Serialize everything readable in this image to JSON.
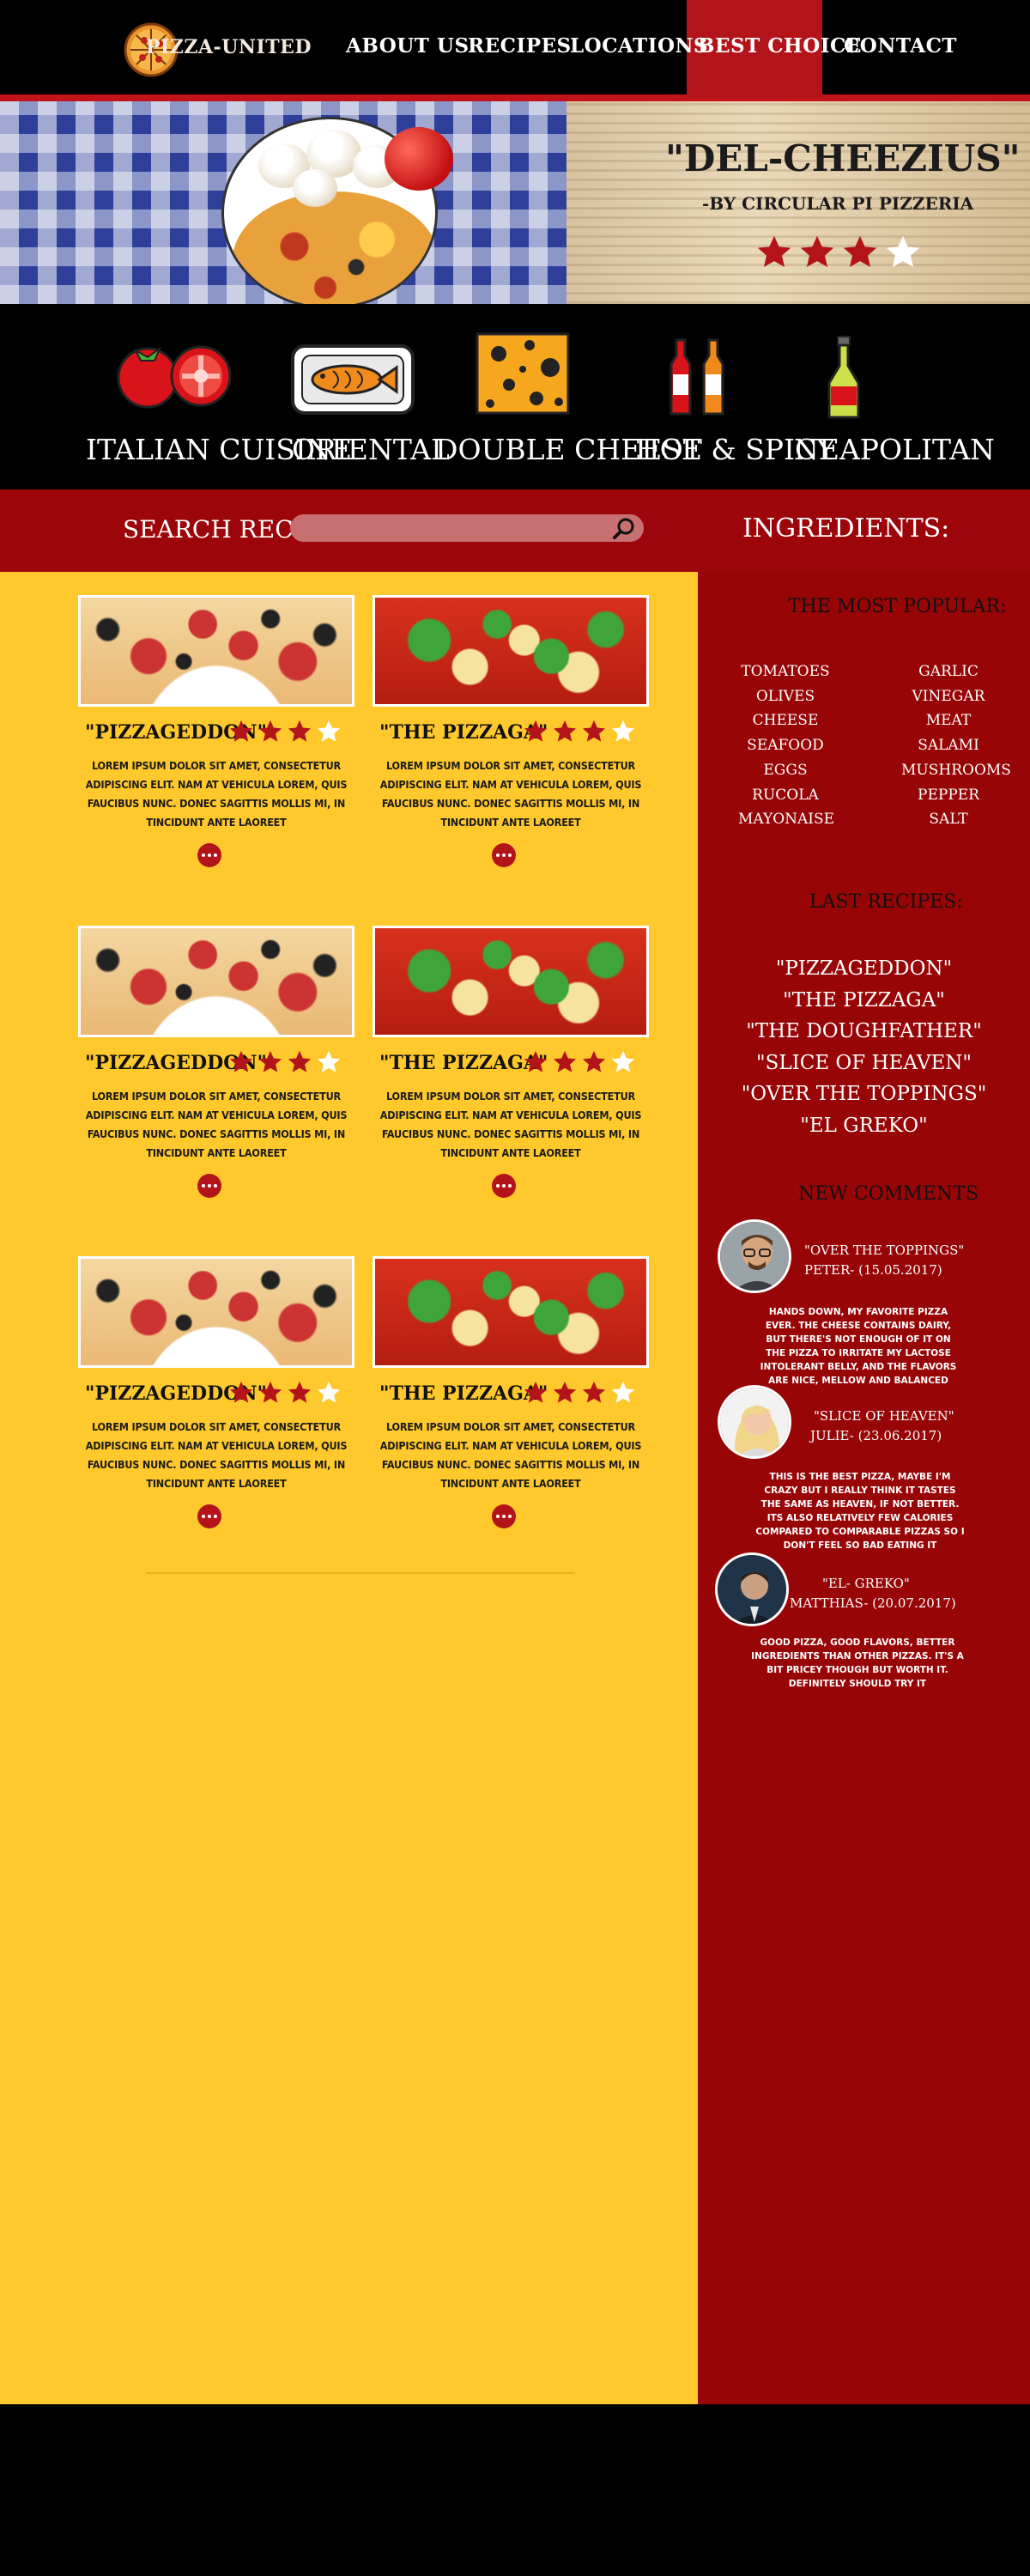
{
  "brand": {
    "name": "PIZZA-UNITED"
  },
  "nav": {
    "items": [
      {
        "label": "ABOUT US"
      },
      {
        "label": "RECIPES"
      },
      {
        "label": "LOCATIONS"
      },
      {
        "label": "BEST CHOICE",
        "active": true
      },
      {
        "label": "CONTACT"
      }
    ]
  },
  "hero": {
    "title": "\"DEL-CHEEZIUS\"",
    "subtitle": "-BY CIRCULAR PI PIZZERIA",
    "rating": 3,
    "rating_max": 4
  },
  "categories": [
    {
      "label": "ITALIAN CUISINE",
      "icon": "tomato-icon"
    },
    {
      "label": "ORIENTAL",
      "icon": "fish-icon"
    },
    {
      "label": "DOUBLE CHEESE",
      "icon": "cheese-icon"
    },
    {
      "label": "HOT & SPICY",
      "icon": "sauce-bottles-icon"
    },
    {
      "label": "NEAPOLITAN",
      "icon": "oil-bottle-icon"
    }
  ],
  "search": {
    "label": "SEARCH RECIPES:",
    "placeholder": "",
    "value": ""
  },
  "ingredients": {
    "title": "INGREDIENTS:",
    "popular_title": "THE MOST POPULAR:",
    "left": [
      "TOMATOES",
      "OLIVES",
      "CHEESE",
      "SEAFOOD",
      "EGGS",
      "RUCOLA",
      "MAYONAISE"
    ],
    "right": [
      "GARLIC",
      "VINEGAR",
      "MEAT",
      "SALAMI",
      "MUSHROOMS",
      "PEPPER",
      "SALT"
    ]
  },
  "last_recipes": {
    "title": "LAST RECIPES:",
    "items": [
      "\"PIZZAGEDDON\"",
      "\"THE PIZZAGA\"",
      "\"THE DOUGHFATHER\"",
      "\"SLICE OF HEAVEN\"",
      "\"OVER THE TOPPINGS\"",
      "\"EL GREKO\""
    ]
  },
  "comments": {
    "title": "NEW COMMENTS",
    "items": [
      {
        "recipe": "\"OVER THE TOPPINGS\"",
        "author": "PETER- (15.05.2017)",
        "body": "HANDS DOWN, MY FAVORITE PIZZA EVER. THE CHEESE CONTAINS DAIRY, BUT THERE'S NOT ENOUGH OF IT ON THE PIZZA TO IRRITATE MY LACTOSE INTOLERANT BELLY, AND THE FLAVORS ARE NICE, MELLOW AND BALANCED",
        "avatar": "man-glasses"
      },
      {
        "recipe": "\"SLICE OF HEAVEN\"",
        "author": "JULIE- (23.06.2017)",
        "body": "THIS IS THE BEST PIZZA, MAYBE I'M CRAZY BUT I REALLY THINK IT TASTES THE SAME AS HEAVEN, IF NOT BETTER. ITS ALSO RELATIVELY FEW CALORIES COMPARED TO COMPARABLE PIZZAS SO I DON'T FEEL SO BAD EATING IT",
        "avatar": "woman-blonde"
      },
      {
        "recipe": "\"EL- GREKO\"",
        "author": "MATTHIAS- (20.07.2017)",
        "body": "GOOD PIZZA, GOOD FLAVORS, BETTER INGREDIENTS THAN OTHER PIZZAS. IT'S A BIT PRICEY THOUGH BUT WORTH IT. DEFINITELY SHOULD TRY IT",
        "avatar": "man-suit"
      }
    ]
  },
  "cards": [
    {
      "title": "\"PIZZAGEDDON\"",
      "rating": 3,
      "image": "pepperoni",
      "text": "LOREM IPSUM DOLOR SIT AMET, CONSECTETUR ADIPISCING ELIT. NAM AT VEHICULA LOREM, QUIS FAUCIBUS NUNC. DONEC SAGITTIS MOLLIS MI, IN TINCIDUNT ANTE LAOREET"
    },
    {
      "title": "\"THE PIZZAGA\"",
      "rating": 3,
      "image": "basil",
      "text": "LOREM IPSUM DOLOR SIT AMET, CONSECTETUR ADIPISCING ELIT. NAM AT VEHICULA LOREM, QUIS FAUCIBUS NUNC. DONEC SAGITTIS MOLLIS MI, IN TINCIDUNT ANTE LAOREET"
    },
    {
      "title": "\"PIZZAGEDDON\"",
      "rating": 3,
      "image": "pepperoni",
      "text": "LOREM IPSUM DOLOR SIT AMET, CONSECTETUR ADIPISCING ELIT. NAM AT VEHICULA LOREM, QUIS FAUCIBUS NUNC. DONEC SAGITTIS MOLLIS MI, IN TINCIDUNT ANTE LAOREET"
    },
    {
      "title": "\"THE PIZZAGA\"",
      "rating": 3,
      "image": "basil",
      "text": "LOREM IPSUM DOLOR SIT AMET, CONSECTETUR ADIPISCING ELIT. NAM AT VEHICULA LOREM, QUIS FAUCIBUS NUNC. DONEC SAGITTIS MOLLIS MI, IN TINCIDUNT ANTE LAOREET"
    },
    {
      "title": "\"PIZZAGEDDON\"",
      "rating": 3,
      "image": "pepperoni",
      "text": "LOREM IPSUM DOLOR SIT AMET, CONSECTETUR ADIPISCING ELIT. NAM AT VEHICULA LOREM, QUIS FAUCIBUS NUNC. DONEC SAGITTIS MOLLIS MI, IN TINCIDUNT ANTE LAOREET"
    },
    {
      "title": "\"THE PIZZAGA\"",
      "rating": 3,
      "image": "basil",
      "text": "LOREM IPSUM DOLOR SIT AMET, CONSECTETUR ADIPISCING ELIT. NAM AT VEHICULA LOREM, QUIS FAUCIBUS NUNC. DONEC SAGITTIS MOLLIS MI, IN TINCIDUNT ANTE LAOREET"
    }
  ],
  "colors": {
    "nav_bg": "#000000",
    "accent_red": "#b3141a",
    "sidebar_red": "#970507",
    "main_yellow": "#ffc82c",
    "star_red": "#b3141a",
    "star_white": "#ffffff"
  }
}
